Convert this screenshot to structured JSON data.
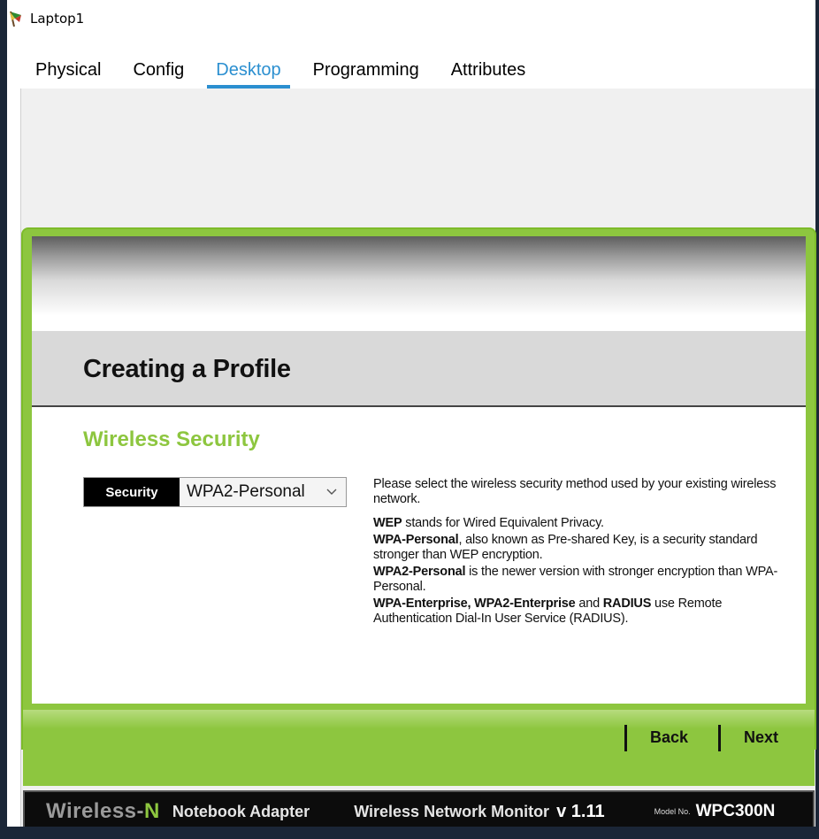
{
  "window": {
    "title": "Laptop1"
  },
  "tabs": [
    {
      "label": "Physical"
    },
    {
      "label": "Config"
    },
    {
      "label": "Desktop"
    },
    {
      "label": "Programming"
    },
    {
      "label": "Attributes"
    }
  ],
  "active_tab": "Desktop",
  "profile": {
    "title": "Creating a Profile",
    "section_title": "Wireless Security",
    "security_label": "Security",
    "security_value": "WPA2-Personal"
  },
  "help": {
    "intro": "Please select the wireless security method used by your existing wireless network.",
    "wep_term": "WEP",
    "wep_text": " stands for Wired Equivalent Privacy.",
    "wpa_term": "WPA-Personal",
    "wpa_text": ", also known as Pre-shared Key, is a security standard stronger than WEP encryption.",
    "wpa2_term": "WPA2-Personal",
    "wpa2_text": " is the newer version with stronger encryption than WPA-Personal.",
    "ent_term": "WPA-Enterprise, WPA2-Enterprise",
    "ent_and": " and ",
    "radius_term": "RADIUS",
    "ent_text": " use Remote Authentication Dial-In User Service (RADIUS)."
  },
  "nav": {
    "back": "Back",
    "next": "Next"
  },
  "footer": {
    "brand_main": "Wireless-",
    "brand_n": "N",
    "adapter": "Notebook Adapter",
    "monitor": "Wireless Network Monitor",
    "version": "v 1.11",
    "model_label": "Model No.",
    "model_value": "WPC300N"
  },
  "colors": {
    "accent_green": "#8dc63f",
    "tab_active": "#2b8fd0",
    "frame": "#1b2637"
  }
}
